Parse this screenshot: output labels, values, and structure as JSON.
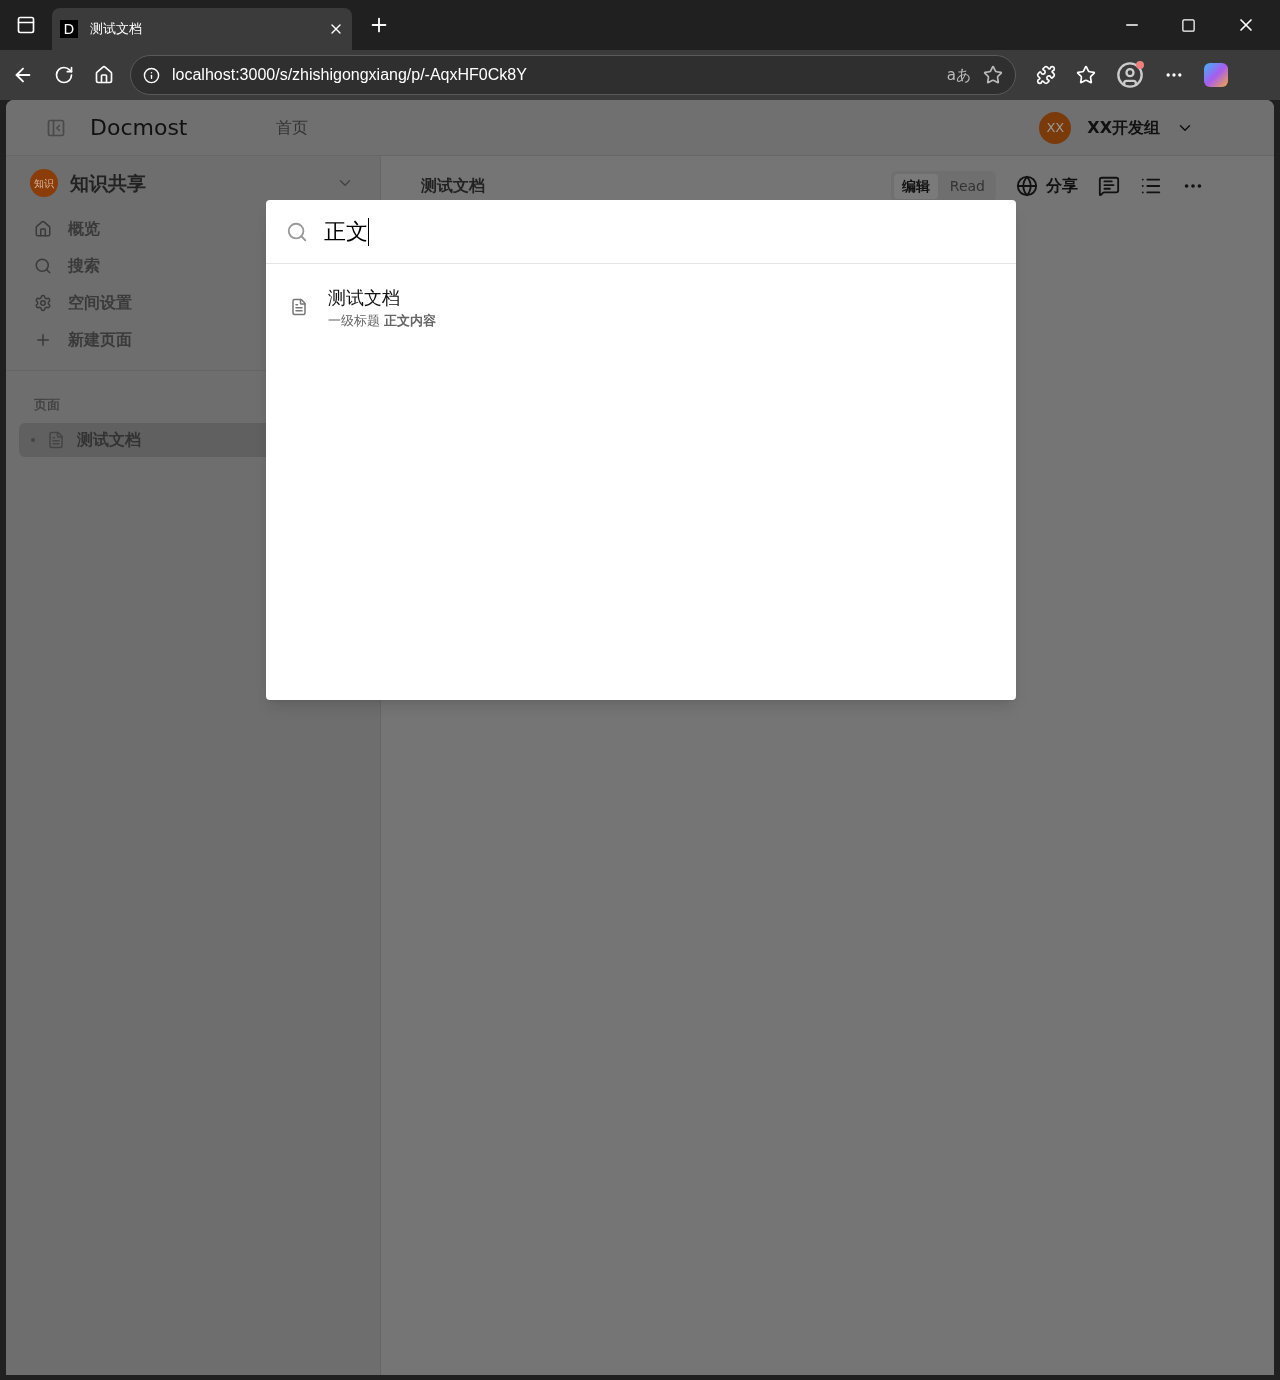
{
  "browser": {
    "tab": {
      "favicon": "D",
      "title": "测试文档"
    },
    "url": "localhost:3000/s/zhishigongxiang/p/-AqxHF0Ck8Y",
    "translate_label": "aあ"
  },
  "header": {
    "logo": "Docmost",
    "nav": [
      "首页"
    ],
    "workspace": {
      "avatar": "XX",
      "name": "XX开发组"
    }
  },
  "sidebar": {
    "space": {
      "avatar": "知识",
      "name": "知识共享"
    },
    "items": [
      {
        "kind": "home",
        "label": "概览"
      },
      {
        "kind": "search",
        "label": "搜索"
      },
      {
        "kind": "settings",
        "label": "空间设置"
      },
      {
        "kind": "add",
        "label": "新建页面"
      }
    ],
    "section_title": "页面",
    "pages": [
      {
        "title": "测试文档",
        "selected": true
      }
    ]
  },
  "page": {
    "title": "测试文档",
    "modes": [
      {
        "label": "编辑",
        "selected": true
      },
      {
        "label": "Read",
        "selected": false
      }
    ],
    "share": "分享"
  },
  "search_dialog": {
    "query": "正文",
    "results": [
      {
        "title": "测试文档",
        "snippet": "一级标题 **正文内容**"
      }
    ]
  }
}
